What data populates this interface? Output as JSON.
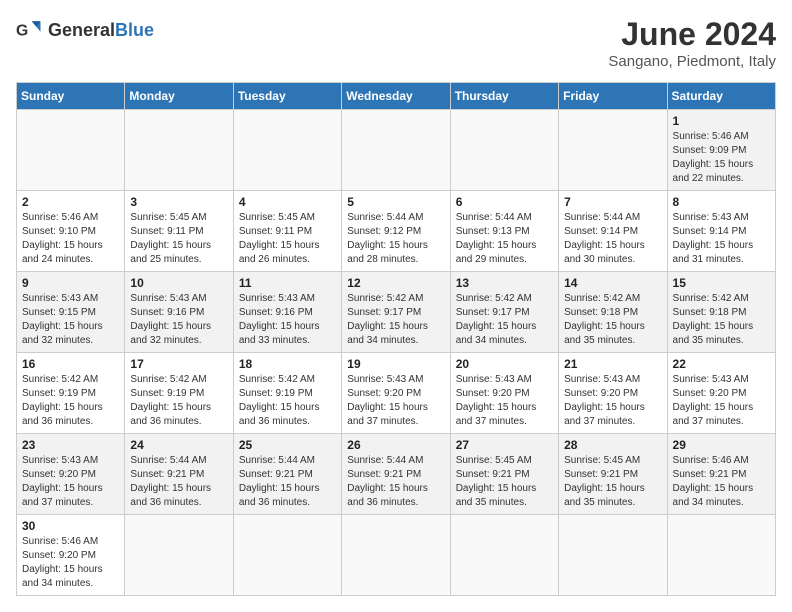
{
  "header": {
    "logo_general": "General",
    "logo_blue": "Blue",
    "month_title": "June 2024",
    "subtitle": "Sangano, Piedmont, Italy"
  },
  "days_of_week": [
    "Sunday",
    "Monday",
    "Tuesday",
    "Wednesday",
    "Thursday",
    "Friday",
    "Saturday"
  ],
  "weeks": [
    [
      {
        "day": "",
        "info": ""
      },
      {
        "day": "",
        "info": ""
      },
      {
        "day": "",
        "info": ""
      },
      {
        "day": "",
        "info": ""
      },
      {
        "day": "",
        "info": ""
      },
      {
        "day": "",
        "info": ""
      },
      {
        "day": "1",
        "info": "Sunrise: 5:46 AM\nSunset: 9:09 PM\nDaylight: 15 hours\nand 22 minutes."
      }
    ],
    [
      {
        "day": "2",
        "info": "Sunrise: 5:46 AM\nSunset: 9:10 PM\nDaylight: 15 hours\nand 24 minutes."
      },
      {
        "day": "3",
        "info": "Sunrise: 5:45 AM\nSunset: 9:11 PM\nDaylight: 15 hours\nand 25 minutes."
      },
      {
        "day": "4",
        "info": "Sunrise: 5:45 AM\nSunset: 9:11 PM\nDaylight: 15 hours\nand 26 minutes."
      },
      {
        "day": "5",
        "info": "Sunrise: 5:44 AM\nSunset: 9:12 PM\nDaylight: 15 hours\nand 28 minutes."
      },
      {
        "day": "6",
        "info": "Sunrise: 5:44 AM\nSunset: 9:13 PM\nDaylight: 15 hours\nand 29 minutes."
      },
      {
        "day": "7",
        "info": "Sunrise: 5:44 AM\nSunset: 9:14 PM\nDaylight: 15 hours\nand 30 minutes."
      },
      {
        "day": "8",
        "info": "Sunrise: 5:43 AM\nSunset: 9:14 PM\nDaylight: 15 hours\nand 31 minutes."
      }
    ],
    [
      {
        "day": "9",
        "info": "Sunrise: 5:43 AM\nSunset: 9:15 PM\nDaylight: 15 hours\nand 32 minutes."
      },
      {
        "day": "10",
        "info": "Sunrise: 5:43 AM\nSunset: 9:16 PM\nDaylight: 15 hours\nand 32 minutes."
      },
      {
        "day": "11",
        "info": "Sunrise: 5:43 AM\nSunset: 9:16 PM\nDaylight: 15 hours\nand 33 minutes."
      },
      {
        "day": "12",
        "info": "Sunrise: 5:42 AM\nSunset: 9:17 PM\nDaylight: 15 hours\nand 34 minutes."
      },
      {
        "day": "13",
        "info": "Sunrise: 5:42 AM\nSunset: 9:17 PM\nDaylight: 15 hours\nand 34 minutes."
      },
      {
        "day": "14",
        "info": "Sunrise: 5:42 AM\nSunset: 9:18 PM\nDaylight: 15 hours\nand 35 minutes."
      },
      {
        "day": "15",
        "info": "Sunrise: 5:42 AM\nSunset: 9:18 PM\nDaylight: 15 hours\nand 35 minutes."
      }
    ],
    [
      {
        "day": "16",
        "info": "Sunrise: 5:42 AM\nSunset: 9:19 PM\nDaylight: 15 hours\nand 36 minutes."
      },
      {
        "day": "17",
        "info": "Sunrise: 5:42 AM\nSunset: 9:19 PM\nDaylight: 15 hours\nand 36 minutes."
      },
      {
        "day": "18",
        "info": "Sunrise: 5:42 AM\nSunset: 9:19 PM\nDaylight: 15 hours\nand 36 minutes."
      },
      {
        "day": "19",
        "info": "Sunrise: 5:43 AM\nSunset: 9:20 PM\nDaylight: 15 hours\nand 37 minutes."
      },
      {
        "day": "20",
        "info": "Sunrise: 5:43 AM\nSunset: 9:20 PM\nDaylight: 15 hours\nand 37 minutes."
      },
      {
        "day": "21",
        "info": "Sunrise: 5:43 AM\nSunset: 9:20 PM\nDaylight: 15 hours\nand 37 minutes."
      },
      {
        "day": "22",
        "info": "Sunrise: 5:43 AM\nSunset: 9:20 PM\nDaylight: 15 hours\nand 37 minutes."
      }
    ],
    [
      {
        "day": "23",
        "info": "Sunrise: 5:43 AM\nSunset: 9:20 PM\nDaylight: 15 hours\nand 37 minutes."
      },
      {
        "day": "24",
        "info": "Sunrise: 5:44 AM\nSunset: 9:21 PM\nDaylight: 15 hours\nand 36 minutes."
      },
      {
        "day": "25",
        "info": "Sunrise: 5:44 AM\nSunset: 9:21 PM\nDaylight: 15 hours\nand 36 minutes."
      },
      {
        "day": "26",
        "info": "Sunrise: 5:44 AM\nSunset: 9:21 PM\nDaylight: 15 hours\nand 36 minutes."
      },
      {
        "day": "27",
        "info": "Sunrise: 5:45 AM\nSunset: 9:21 PM\nDaylight: 15 hours\nand 35 minutes."
      },
      {
        "day": "28",
        "info": "Sunrise: 5:45 AM\nSunset: 9:21 PM\nDaylight: 15 hours\nand 35 minutes."
      },
      {
        "day": "29",
        "info": "Sunrise: 5:46 AM\nSunset: 9:21 PM\nDaylight: 15 hours\nand 34 minutes."
      }
    ],
    [
      {
        "day": "30",
        "info": "Sunrise: 5:46 AM\nSunset: 9:20 PM\nDaylight: 15 hours\nand 34 minutes."
      },
      {
        "day": "",
        "info": ""
      },
      {
        "day": "",
        "info": ""
      },
      {
        "day": "",
        "info": ""
      },
      {
        "day": "",
        "info": ""
      },
      {
        "day": "",
        "info": ""
      },
      {
        "day": "",
        "info": ""
      }
    ]
  ]
}
